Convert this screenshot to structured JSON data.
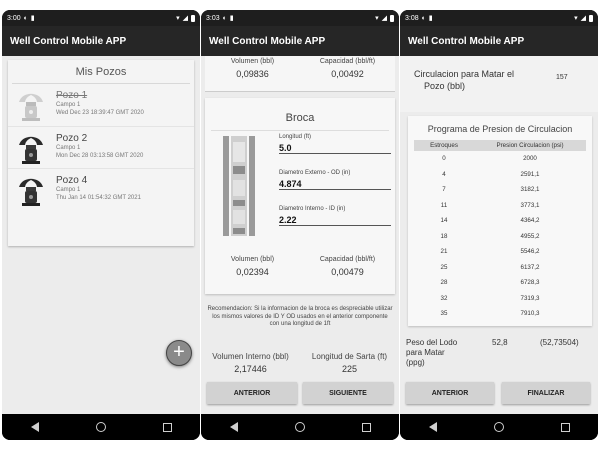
{
  "app_title": "Well Control Mobile APP",
  "screens": [
    {
      "time": "3:00",
      "title": "Mis Pozos",
      "wells": [
        {
          "name": "Pozo 1",
          "campo": "Campo 1",
          "date": "Wed Dec 23 18:39:47 GMT 2020",
          "deleted": true
        },
        {
          "name": "Pozo 2",
          "campo": "Campo 1",
          "date": "Mon Dec 28 03:13:58 GMT 2020",
          "deleted": false
        },
        {
          "name": "Pozo 4",
          "campo": "Campo 1",
          "date": "Thu Jan 14 01:54:32 GMT 2021",
          "deleted": false
        }
      ],
      "fab_label": "+"
    },
    {
      "time": "3:03",
      "top_left_label": "Volumen (bbl)",
      "top_left_value": "0,09836",
      "top_right_label": "Capacidad (bbl/ft)",
      "top_right_value": "0,00492",
      "section_title": "Broca",
      "fields": [
        {
          "label": "Longitud (ft)",
          "value": "5.0"
        },
        {
          "label": "Diametro Externo - OD (in)",
          "value": "4.874"
        },
        {
          "label": "Diametro Interno - ID (in)",
          "value": "2.22"
        }
      ],
      "vol_label": "Volumen (bbl)",
      "vol_value": "0,02394",
      "cap_label": "Capacidad (bbl/ft)",
      "cap_value": "0,00479",
      "note": "Recomendacion: Si la informacion de la broca es despreciable utilizar los mismos valores de ID Y OD usados en el anterior componente con una longitud de 1ft",
      "vol_interno_label": "Volumen Interno (bbl)",
      "vol_interno_value": "2,17446",
      "long_sarta_label": "Longitud de Sarta (ft)",
      "long_sarta_value": "225",
      "btn_prev": "ANTERIOR",
      "btn_next": "SIGUIENTE"
    },
    {
      "time": "3:08",
      "circ_label_1": "Circulacion para Matar el",
      "circ_label_2": "Pozo (bbl)",
      "circ_value": "157",
      "program_title": "Programa de Presion de Circulacion",
      "col_strokes": "Estroques",
      "col_pressure": "Presion Circulacion (psi)",
      "rows": [
        [
          "0",
          "2000"
        ],
        [
          "4",
          "2591,1"
        ],
        [
          "7",
          "3182,1"
        ],
        [
          "11",
          "3773,1"
        ],
        [
          "14",
          "4364,2"
        ],
        [
          "18",
          "4955,2"
        ],
        [
          "21",
          "5546,2"
        ],
        [
          "25",
          "6137,2"
        ],
        [
          "28",
          "6728,3"
        ],
        [
          "32",
          "7319,3"
        ],
        [
          "35",
          "7910,3"
        ]
      ],
      "lodo_label_1": "Peso del Lodo",
      "lodo_label_2": "para Matar",
      "lodo_label_3": "(ppg)",
      "lodo_value": "52,8",
      "lodo_value_2": "(52,73504)",
      "btn_prev": "ANTERIOR",
      "btn_finish": "FINALIZAR"
    }
  ]
}
